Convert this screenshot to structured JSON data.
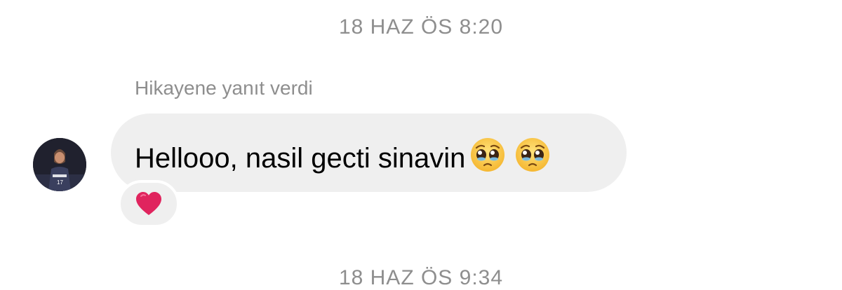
{
  "thread": {
    "timestamps": [
      "18 HAZ ÖS 8:20",
      "18 HAZ ÖS 9:34"
    ],
    "reply_caption": "Hikayene yanıt verdi",
    "message": {
      "text": "Hellooo, nasil gecti sinavin",
      "emojis": [
        "pleading-face-icon",
        "pleading-face-icon"
      ],
      "reaction": "red-heart-icon"
    }
  },
  "colors": {
    "bubble": "#efefef",
    "meta_text": "#8e8e8e",
    "heart": "#e0245e"
  }
}
